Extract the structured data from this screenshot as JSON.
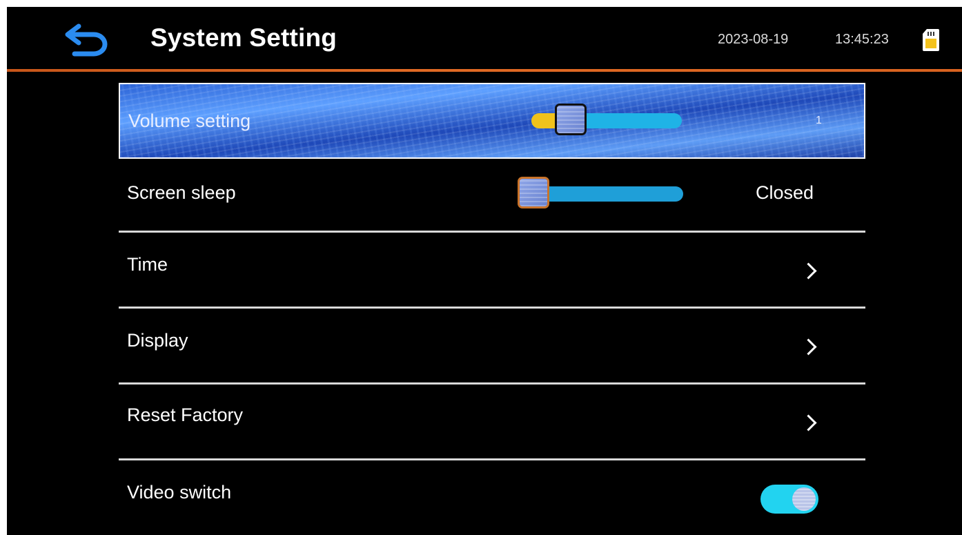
{
  "header": {
    "title": "System Setting",
    "date": "2023-08-19",
    "time": "13:45:23",
    "back_icon": "back-arrow-icon",
    "storage_icon": "sd-card-icon",
    "accent_color": "#e06a24"
  },
  "settings": {
    "volume": {
      "label": "Volume setting",
      "level": 0.2,
      "value_text": "1"
    },
    "screen_sleep": {
      "label": "Screen sleep",
      "level": 0.0,
      "value_text": "Closed"
    },
    "time": {
      "label": "Time"
    },
    "display": {
      "label": "Display"
    },
    "reset_factory": {
      "label": "Reset Factory"
    },
    "video_switch": {
      "label": "Video switch",
      "on": true
    }
  },
  "colors": {
    "background": "#000000",
    "selected_row": "#2c63d6",
    "slider_track": "#1f9fd8",
    "slider_fill": "#f0c21b",
    "toggle_on": "#22d3f0"
  }
}
